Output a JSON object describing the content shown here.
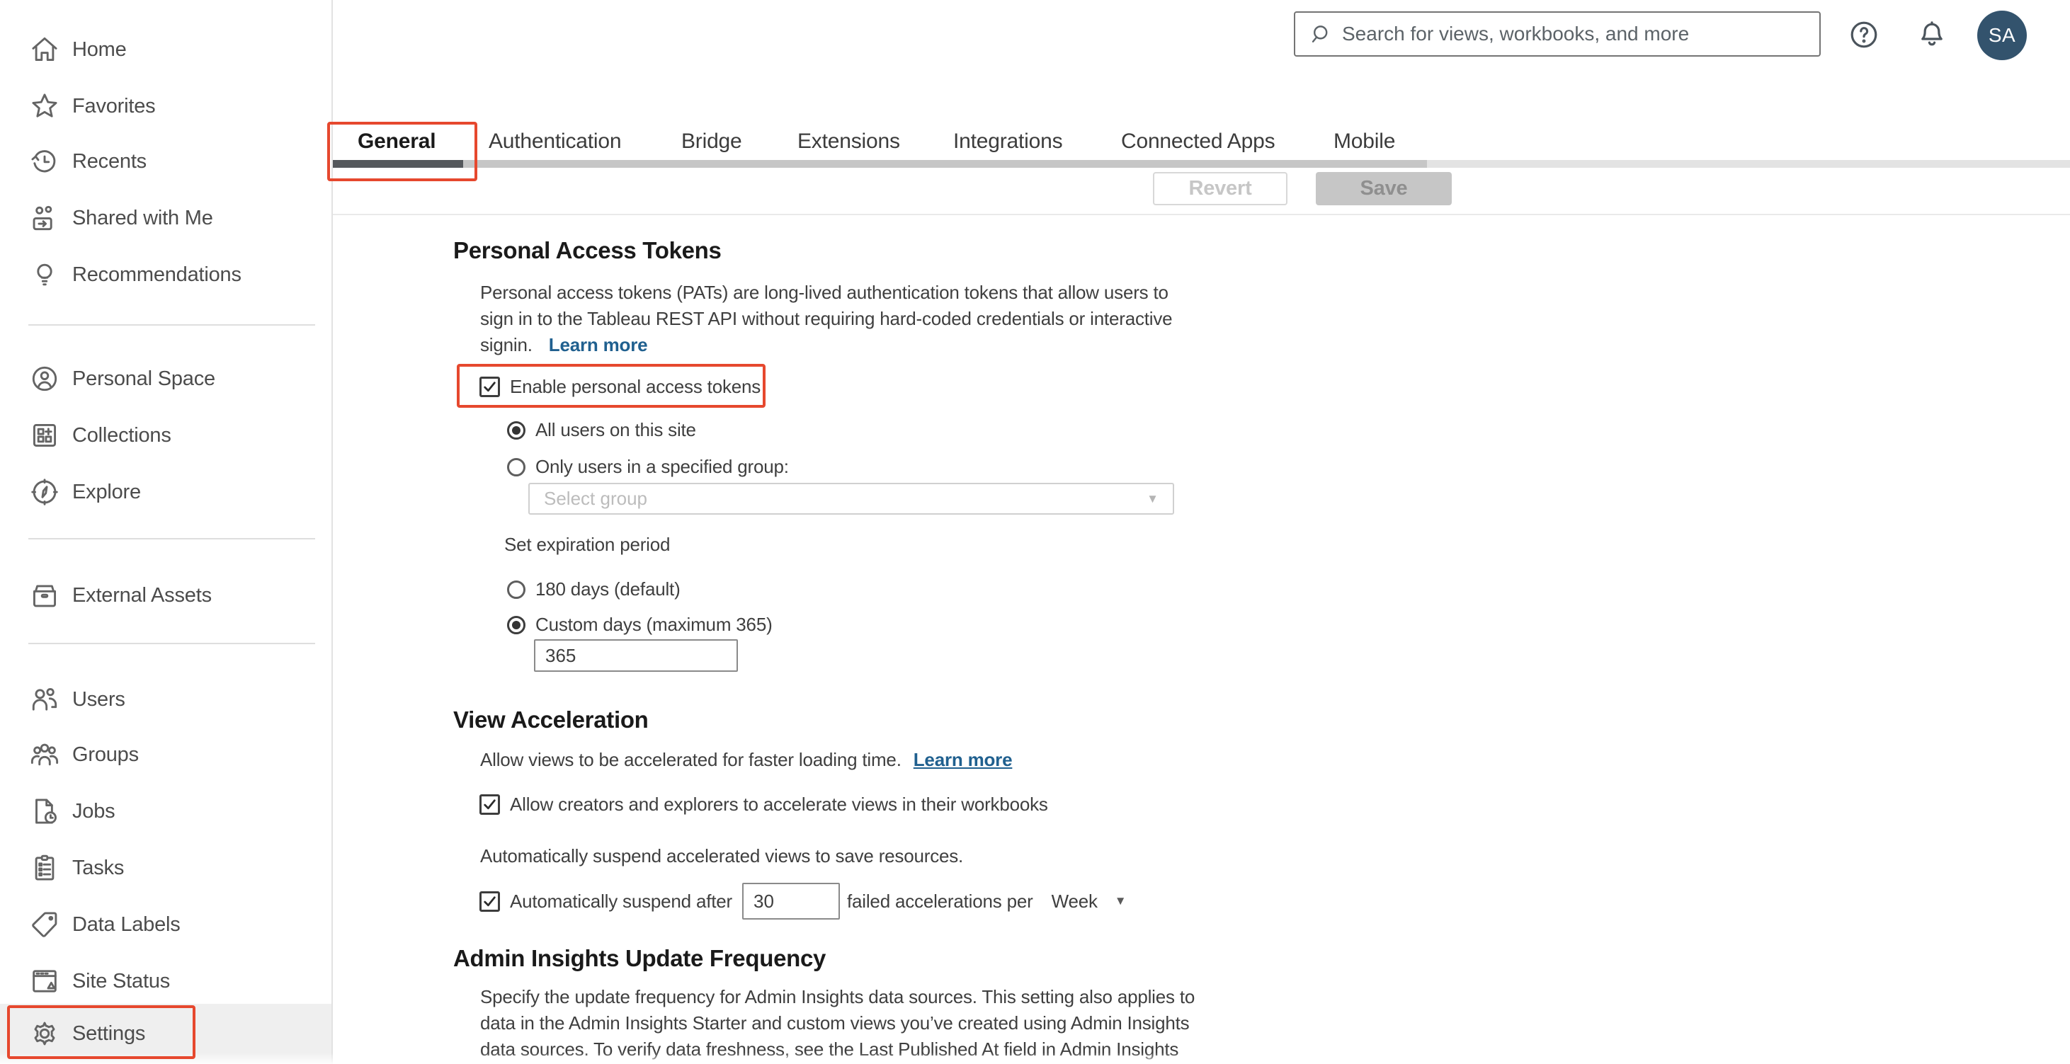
{
  "topbar": {
    "search_placeholder": "Search for views, workbooks, and more",
    "avatar_initials": "SA"
  },
  "sidebar": {
    "items": [
      {
        "label": "Home",
        "icon": "home-icon"
      },
      {
        "label": "Favorites",
        "icon": "star-icon"
      },
      {
        "label": "Recents",
        "icon": "history-icon"
      },
      {
        "label": "Shared with Me",
        "icon": "shared-icon"
      },
      {
        "label": "Recommendations",
        "icon": "lightbulb-icon"
      },
      {
        "label": "Personal Space",
        "icon": "person-circle-icon"
      },
      {
        "label": "Collections",
        "icon": "collections-icon"
      },
      {
        "label": "Explore",
        "icon": "compass-icon"
      },
      {
        "label": "External Assets",
        "icon": "drawer-icon"
      },
      {
        "label": "Users",
        "icon": "users-icon"
      },
      {
        "label": "Groups",
        "icon": "groups-icon"
      },
      {
        "label": "Jobs",
        "icon": "jobs-icon"
      },
      {
        "label": "Tasks",
        "icon": "tasks-icon"
      },
      {
        "label": "Data Labels",
        "icon": "tag-icon"
      },
      {
        "label": "Site Status",
        "icon": "site-status-icon"
      },
      {
        "label": "Settings",
        "icon": "gear-icon"
      }
    ]
  },
  "tabs": {
    "active": "General",
    "items": [
      {
        "label": "General"
      },
      {
        "label": "Authentication"
      },
      {
        "label": "Bridge"
      },
      {
        "label": "Extensions"
      },
      {
        "label": "Integrations"
      },
      {
        "label": "Connected Apps"
      },
      {
        "label": "Mobile"
      }
    ]
  },
  "actions": {
    "revert": "Revert",
    "save": "Save"
  },
  "sections": {
    "pat": {
      "title": "Personal Access Tokens",
      "description_lines": [
        "Personal access tokens (PATs) are long-lived authentication tokens that allow users to",
        "sign in to the Tableau REST API without requiring hard-coded credentials or interactive",
        "signin."
      ],
      "learn_more": "Learn more",
      "enable_checkbox": "Enable personal access tokens",
      "radio_all_users": "All users on this site",
      "radio_specified_group": "Only users in a specified group:",
      "group_placeholder": "Select group",
      "expiration_label": "Set expiration period",
      "radio_default_days": "180 days (default)",
      "radio_custom_days": "Custom days (maximum 365)",
      "custom_days_value": "365"
    },
    "view_acceleration": {
      "title": "View Acceleration",
      "description": "Allow views to be accelerated for faster loading time.",
      "learn_more": "Learn more",
      "allow_checkbox": "Allow creators and explorers to accelerate views in their workbooks",
      "suspend_note": "Automatically suspend accelerated views to save resources.",
      "suspend_prefix": "Automatically suspend after",
      "suspend_value": "30",
      "suspend_suffix": "failed accelerations per",
      "suspend_period": "Week"
    },
    "admin_insights": {
      "title": "Admin Insights Update Frequency",
      "description_lines": [
        "Specify the update frequency for Admin Insights data sources. This setting also applies to",
        "data in the Admin Insights Starter and custom views you’ve created using Admin Insights",
        "data sources. To verify data freshness, see the Last Published At field in Admin Insights"
      ]
    }
  },
  "colors": {
    "annotation_red": "#e6482e",
    "link_blue": "#20608f",
    "avatar_bg": "#33536d",
    "active_tab_underline": "#55585c"
  }
}
